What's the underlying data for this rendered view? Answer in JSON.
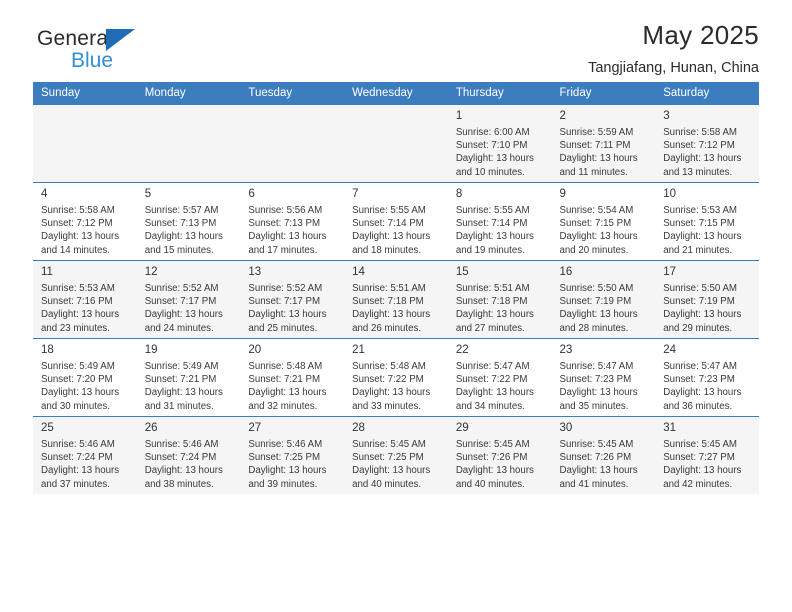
{
  "brand": {
    "line1": "General",
    "line2": "Blue",
    "accent": "#2f90d8",
    "triangle_color": "#1f6cb4"
  },
  "header": {
    "title": "May 2025",
    "subtitle": "Tangjiafang, Hunan, China"
  },
  "theme": {
    "header_bg": "#3c7dbf",
    "header_text": "#ffffff",
    "alt_row_bg": "#f5f5f5"
  },
  "weekday_headers": [
    "Sunday",
    "Monday",
    "Tuesday",
    "Wednesday",
    "Thursday",
    "Friday",
    "Saturday"
  ],
  "weeks": [
    [
      {
        "day": "",
        "info": "",
        "empty": true
      },
      {
        "day": "",
        "info": "",
        "empty": true
      },
      {
        "day": "",
        "info": "",
        "empty": true
      },
      {
        "day": "",
        "info": "",
        "empty": true
      },
      {
        "day": "1",
        "info": "Sunrise: 6:00 AM\nSunset: 7:10 PM\nDaylight: 13 hours\nand 10 minutes."
      },
      {
        "day": "2",
        "info": "Sunrise: 5:59 AM\nSunset: 7:11 PM\nDaylight: 13 hours\nand 11 minutes."
      },
      {
        "day": "3",
        "info": "Sunrise: 5:58 AM\nSunset: 7:12 PM\nDaylight: 13 hours\nand 13 minutes."
      }
    ],
    [
      {
        "day": "4",
        "info": "Sunrise: 5:58 AM\nSunset: 7:12 PM\nDaylight: 13 hours\nand 14 minutes."
      },
      {
        "day": "5",
        "info": "Sunrise: 5:57 AM\nSunset: 7:13 PM\nDaylight: 13 hours\nand 15 minutes."
      },
      {
        "day": "6",
        "info": "Sunrise: 5:56 AM\nSunset: 7:13 PM\nDaylight: 13 hours\nand 17 minutes."
      },
      {
        "day": "7",
        "info": "Sunrise: 5:55 AM\nSunset: 7:14 PM\nDaylight: 13 hours\nand 18 minutes."
      },
      {
        "day": "8",
        "info": "Sunrise: 5:55 AM\nSunset: 7:14 PM\nDaylight: 13 hours\nand 19 minutes."
      },
      {
        "day": "9",
        "info": "Sunrise: 5:54 AM\nSunset: 7:15 PM\nDaylight: 13 hours\nand 20 minutes."
      },
      {
        "day": "10",
        "info": "Sunrise: 5:53 AM\nSunset: 7:15 PM\nDaylight: 13 hours\nand 21 minutes."
      }
    ],
    [
      {
        "day": "11",
        "info": "Sunrise: 5:53 AM\nSunset: 7:16 PM\nDaylight: 13 hours\nand 23 minutes."
      },
      {
        "day": "12",
        "info": "Sunrise: 5:52 AM\nSunset: 7:17 PM\nDaylight: 13 hours\nand 24 minutes."
      },
      {
        "day": "13",
        "info": "Sunrise: 5:52 AM\nSunset: 7:17 PM\nDaylight: 13 hours\nand 25 minutes."
      },
      {
        "day": "14",
        "info": "Sunrise: 5:51 AM\nSunset: 7:18 PM\nDaylight: 13 hours\nand 26 minutes."
      },
      {
        "day": "15",
        "info": "Sunrise: 5:51 AM\nSunset: 7:18 PM\nDaylight: 13 hours\nand 27 minutes."
      },
      {
        "day": "16",
        "info": "Sunrise: 5:50 AM\nSunset: 7:19 PM\nDaylight: 13 hours\nand 28 minutes."
      },
      {
        "day": "17",
        "info": "Sunrise: 5:50 AM\nSunset: 7:19 PM\nDaylight: 13 hours\nand 29 minutes."
      }
    ],
    [
      {
        "day": "18",
        "info": "Sunrise: 5:49 AM\nSunset: 7:20 PM\nDaylight: 13 hours\nand 30 minutes."
      },
      {
        "day": "19",
        "info": "Sunrise: 5:49 AM\nSunset: 7:21 PM\nDaylight: 13 hours\nand 31 minutes."
      },
      {
        "day": "20",
        "info": "Sunrise: 5:48 AM\nSunset: 7:21 PM\nDaylight: 13 hours\nand 32 minutes."
      },
      {
        "day": "21",
        "info": "Sunrise: 5:48 AM\nSunset: 7:22 PM\nDaylight: 13 hours\nand 33 minutes."
      },
      {
        "day": "22",
        "info": "Sunrise: 5:47 AM\nSunset: 7:22 PM\nDaylight: 13 hours\nand 34 minutes."
      },
      {
        "day": "23",
        "info": "Sunrise: 5:47 AM\nSunset: 7:23 PM\nDaylight: 13 hours\nand 35 minutes."
      },
      {
        "day": "24",
        "info": "Sunrise: 5:47 AM\nSunset: 7:23 PM\nDaylight: 13 hours\nand 36 minutes."
      }
    ],
    [
      {
        "day": "25",
        "info": "Sunrise: 5:46 AM\nSunset: 7:24 PM\nDaylight: 13 hours\nand 37 minutes."
      },
      {
        "day": "26",
        "info": "Sunrise: 5:46 AM\nSunset: 7:24 PM\nDaylight: 13 hours\nand 38 minutes."
      },
      {
        "day": "27",
        "info": "Sunrise: 5:46 AM\nSunset: 7:25 PM\nDaylight: 13 hours\nand 39 minutes."
      },
      {
        "day": "28",
        "info": "Sunrise: 5:45 AM\nSunset: 7:25 PM\nDaylight: 13 hours\nand 40 minutes."
      },
      {
        "day": "29",
        "info": "Sunrise: 5:45 AM\nSunset: 7:26 PM\nDaylight: 13 hours\nand 40 minutes."
      },
      {
        "day": "30",
        "info": "Sunrise: 5:45 AM\nSunset: 7:26 PM\nDaylight: 13 hours\nand 41 minutes."
      },
      {
        "day": "31",
        "info": "Sunrise: 5:45 AM\nSunset: 7:27 PM\nDaylight: 13 hours\nand 42 minutes."
      }
    ]
  ]
}
